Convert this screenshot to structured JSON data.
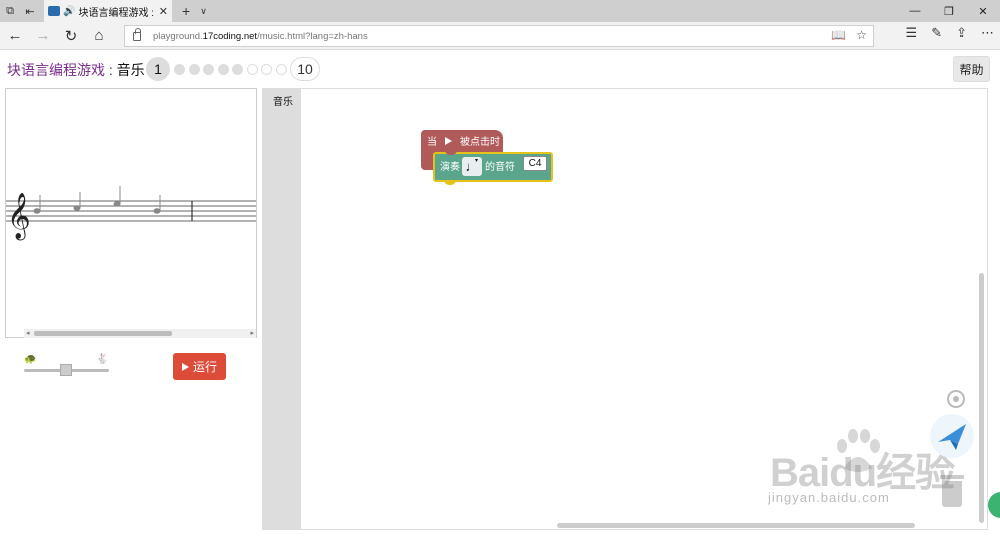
{
  "browser": {
    "tab_title": "块语言编程游戏 : 音",
    "url_prefix": "playground.",
    "url_domain": "17coding.net",
    "url_path": "/music.html?lang=zh-hans"
  },
  "page": {
    "title_game": "块语言编程游戏",
    "title_sep": " : ",
    "title_level": "音乐",
    "level_current": "1",
    "level_last": "10",
    "help_label": "帮助"
  },
  "controls": {
    "run_label": "运行"
  },
  "workspace": {
    "category_label": "音乐",
    "event_block": {
      "when_label": "当",
      "clicked_label": "被点击时"
    },
    "play_block": {
      "label": "演奏",
      "note_glyph": "♩",
      "suffix_label": "的音符",
      "pitch": "C4"
    }
  },
  "watermark": {
    "brand": "Bai",
    "brand2": "du",
    "cn": "经验",
    "site": "jingyan.baidu.com"
  },
  "icons": {
    "tab_favicon": "scratch-block-icon",
    "speaker": "speaker-icon"
  }
}
